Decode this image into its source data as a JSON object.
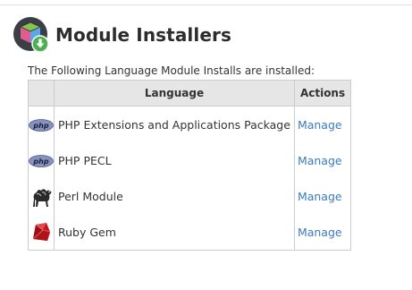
{
  "page": {
    "title": "Module Installers",
    "intro": "The Following Language Module Installs are installed:"
  },
  "table": {
    "headers": {
      "language": "Language",
      "actions": "Actions"
    },
    "rows": [
      {
        "icon": "php-icon",
        "icon_text": "php",
        "name": "PHP Extensions and Applications Package",
        "action": "Manage"
      },
      {
        "icon": "php-icon",
        "icon_text": "php",
        "name": "PHP PECL",
        "action": "Manage"
      },
      {
        "icon": "perl-camel-icon",
        "name": "Perl Module",
        "action": "Manage"
      },
      {
        "icon": "ruby-gem-icon",
        "name": "Ruby Gem",
        "action": "Manage"
      }
    ]
  },
  "colors": {
    "link": "#3b7bbf",
    "header_bg": "#e6e6e6",
    "border": "#cccccc",
    "download_badge": "#4caf50"
  }
}
